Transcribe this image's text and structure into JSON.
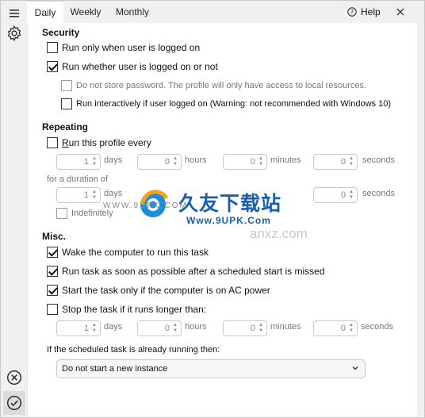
{
  "tabs": [
    {
      "label": "Daily",
      "active": true
    },
    {
      "label": "Weekly",
      "active": false
    },
    {
      "label": "Monthly",
      "active": false
    }
  ],
  "help_label": "Help",
  "security": {
    "heading": "Security",
    "run_only_logged_on": {
      "label": "Run only when user is logged on",
      "checked": false
    },
    "run_whether_logged_on": {
      "label": "Run whether user is logged on or not",
      "checked": true
    },
    "do_not_store_password": {
      "label": "Do not store password. The profile will only have access to local resources.",
      "checked": false
    },
    "run_interactively": {
      "label": "Run interactively if user logged on (Warning: not recommended with Windows 10)",
      "checked": false
    }
  },
  "repeating": {
    "heading": "Repeating",
    "run_every_label_prefix": "R",
    "run_every_label_rest": "un this profile every",
    "run_every_checked": false,
    "every": {
      "days": "1",
      "hours": "0",
      "minutes": "0",
      "seconds": "0"
    },
    "duration_label": "for a duration of",
    "duration": {
      "days": "1",
      "seconds": "0"
    },
    "indefinitely_label": "Indefinitely",
    "units": {
      "days": "days",
      "hours": "hours",
      "minutes": "minutes",
      "seconds": "seconds"
    }
  },
  "misc": {
    "heading": "Misc.",
    "wake_computer": {
      "label": "Wake the computer to run this task",
      "checked": true
    },
    "run_asap": {
      "label": "Run task as soon as possible after a scheduled start is missed",
      "checked": true
    },
    "ac_power": {
      "label": "Start the task only if the computer is on AC power",
      "checked": true
    },
    "stop_if_longer": {
      "label": "Stop the task if it runs longer than:",
      "checked": false
    },
    "stop_after": {
      "days": "1",
      "hours": "0",
      "minutes": "0",
      "seconds": "0"
    },
    "already_running_label": "If the scheduled task is already running then:",
    "already_running_value": "Do not start a new instance"
  },
  "watermark": {
    "brand_cn": "久友下载站",
    "url1": "WWW.9UPK.COM",
    "url2": "Www.9UPK.Com",
    "url3": "anxz.com"
  },
  "colors": {
    "panel_bg": "#ffffff",
    "chrome_bg": "#f0f0f0",
    "accent_logo_blue": "#1a8fd8",
    "accent_logo_orange": "#f7a21b"
  }
}
